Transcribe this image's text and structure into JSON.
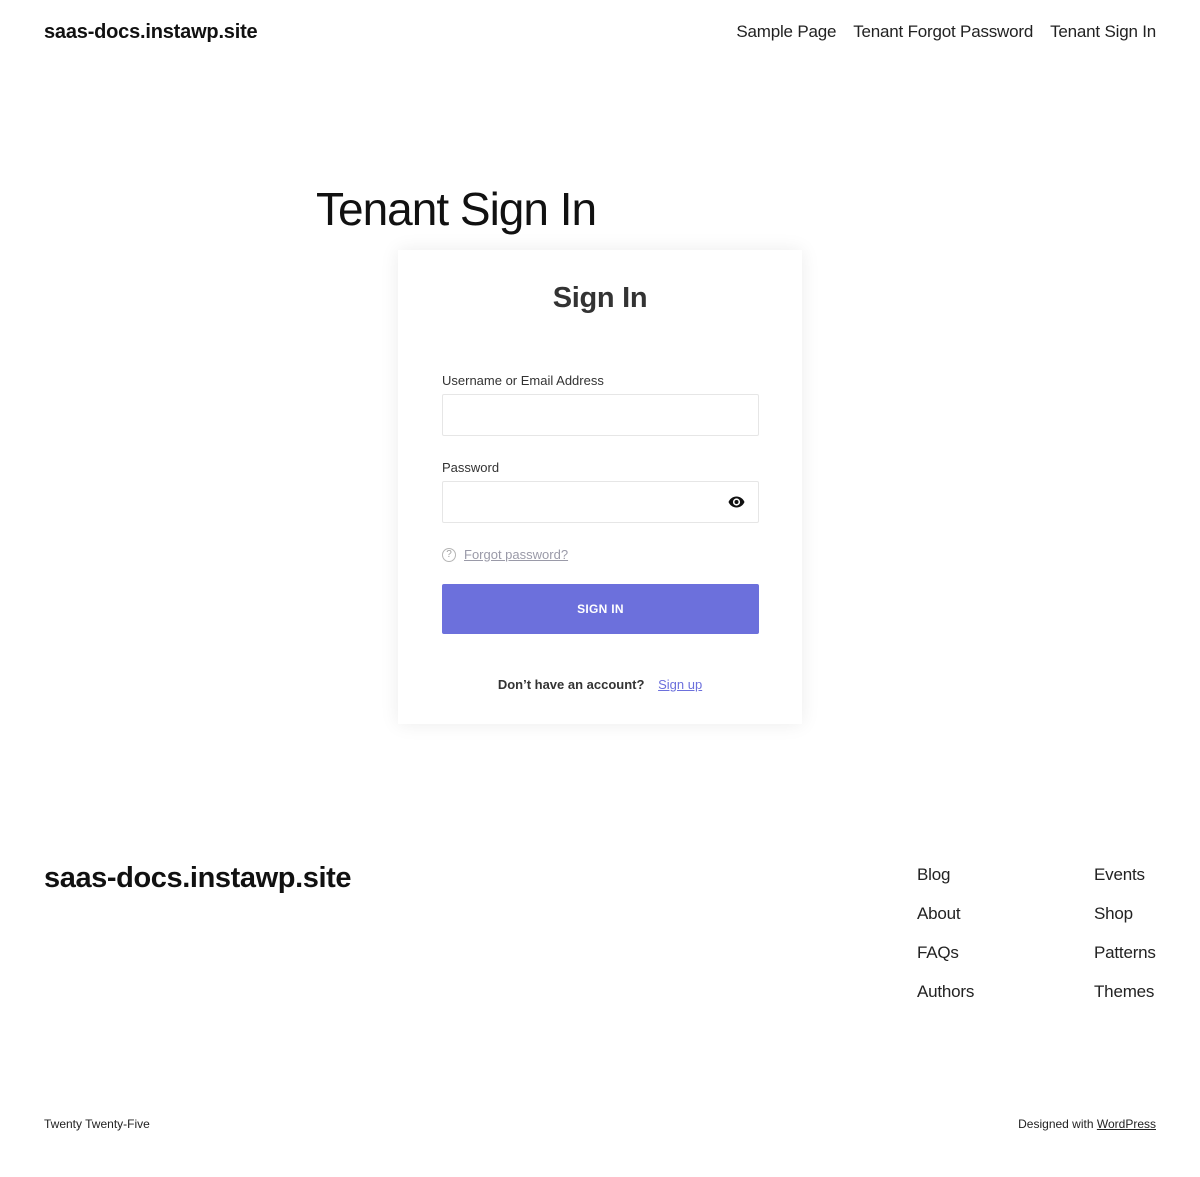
{
  "header": {
    "site_title": "saas-docs.instawp.site",
    "nav": [
      {
        "label": "Sample Page"
      },
      {
        "label": "Tenant Forgot Password"
      },
      {
        "label": "Tenant Sign In"
      }
    ]
  },
  "page": {
    "heading": "Tenant Sign In"
  },
  "form": {
    "title": "Sign In",
    "username_label": "Username or Email Address",
    "username_value": "",
    "password_label": "Password",
    "password_value": "",
    "eye_icon": "eye-icon",
    "help_icon": "help-circle-icon",
    "help_glyph": "?",
    "forgot_link": "Forgot password?",
    "submit_label": "SIGN IN",
    "signup_prompt": "Don’t have an account?",
    "signup_link": "Sign up"
  },
  "footer": {
    "site_title": "saas-docs.instawp.site",
    "col1": [
      {
        "label": "Blog"
      },
      {
        "label": "About"
      },
      {
        "label": "FAQs"
      },
      {
        "label": "Authors"
      }
    ],
    "col2": [
      {
        "label": "Events"
      },
      {
        "label": "Shop"
      },
      {
        "label": "Patterns"
      },
      {
        "label": "Themes"
      }
    ],
    "theme_credit": "Twenty Twenty-Five",
    "designed_with": "Designed with",
    "wordpress_link": "WordPress"
  },
  "colors": {
    "accent": "#6c70dc",
    "text": "#111111",
    "muted_link": "#9a9aa8"
  }
}
